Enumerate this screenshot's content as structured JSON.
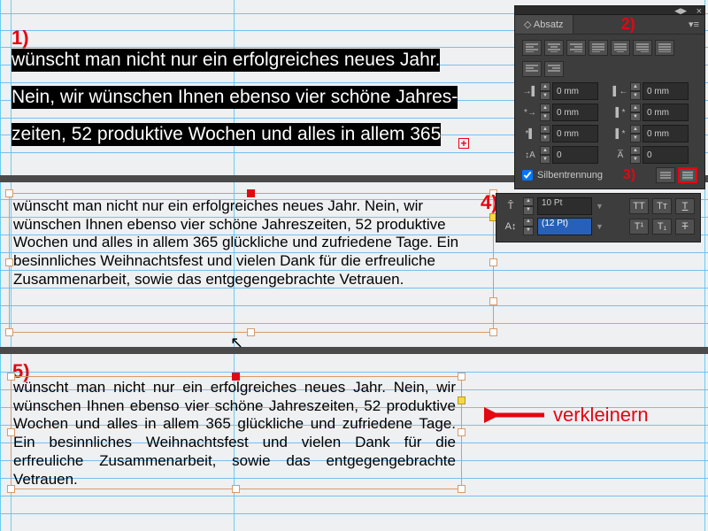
{
  "annotations": {
    "a1": "1)",
    "a2": "2)",
    "a3": "3)",
    "a4": "4)",
    "a5": "5)"
  },
  "sec1": {
    "l1": "wünscht man nicht nur ein erfolgreiches neues Jahr.",
    "l2": "Nein, wir wünschen Ihnen ebenso vier schöne Jahres-",
    "l3": "zeiten, 52 produktive Wochen und alles in allem 365"
  },
  "overset": "+",
  "sec2": "wünscht man nicht nur ein erfolgreiches neues Jahr. Nein, wir wünschen Ihnen ebenso vier schöne Jahreszeiten, 52 produktive Wochen und alles in allem 365 glückliche und zufriedene Tage. Ein besinnliches Weihnachtsfest und vielen Dank für die erfreuliche Zusammenarbeit, sowie das entgegengebrachte Vetrauen.",
  "sec3": "wünscht man nicht nur ein erfolgreiches neues Jahr. Nein, wir wünschen Ihnen ebenso vier schöne Jahres­zeiten, 52 produktive Wochen und alles in allem 365 glückliche und zufriedene Tage. Ein besinnliches Weih­nachtsfest und vielen Dank für die erfreuliche Zusam­menarbeit, sowie das entgegengebrachte Vetrauen.",
  "absatz": {
    "title": "Absatz",
    "indent_left": "0 mm",
    "indent_right": "0 mm",
    "first_line": "0 mm",
    "last_line": "0 mm",
    "space_before": "0 mm",
    "space_after": "0 mm",
    "drop_lines": "0",
    "drop_chars": "0",
    "hyphenation_label": "Silbentrennung",
    "hyphenation_checked": true
  },
  "char": {
    "size": "10 Pt",
    "leading": "(12 Pt)"
  },
  "arrow_label": "verkleinern"
}
